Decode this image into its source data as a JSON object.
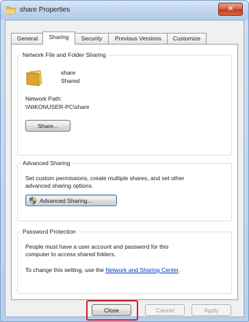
{
  "window": {
    "title": "share Properties",
    "close_glyph": "✕",
    "title_icon": "folder-icon"
  },
  "tabs": [
    {
      "label": "General"
    },
    {
      "label": "Sharing",
      "active": true
    },
    {
      "label": "Security"
    },
    {
      "label": "Previous Versions"
    },
    {
      "label": "Customize"
    }
  ],
  "network_sharing": {
    "group_label": "Network File and Folder Sharing",
    "folder_name": "share",
    "folder_status": "Shared",
    "network_path_label": "Network Path:",
    "network_path_value": "\\\\NIKONUSER-PC\\share",
    "share_button": "Share..."
  },
  "advanced_sharing": {
    "group_label": "Advanced Sharing",
    "description_line1": "Set custom permissions, create multiple shares, and set other",
    "description_line2": "advanced sharing options.",
    "button_label": "Advanced Sharing..."
  },
  "password_protection": {
    "group_label": "Password Protection",
    "description_line1": "People must have a user account and password for this",
    "description_line2": "computer to access shared folders.",
    "change_text": "To change this setting, use the",
    "link_text": "Network and Sharing Center",
    "trailing": "."
  },
  "footer": {
    "close": "Close",
    "cancel": "Cancel",
    "apply": "Apply"
  },
  "colors": {
    "highlight": "#d21b2a",
    "link": "#0033cc"
  }
}
